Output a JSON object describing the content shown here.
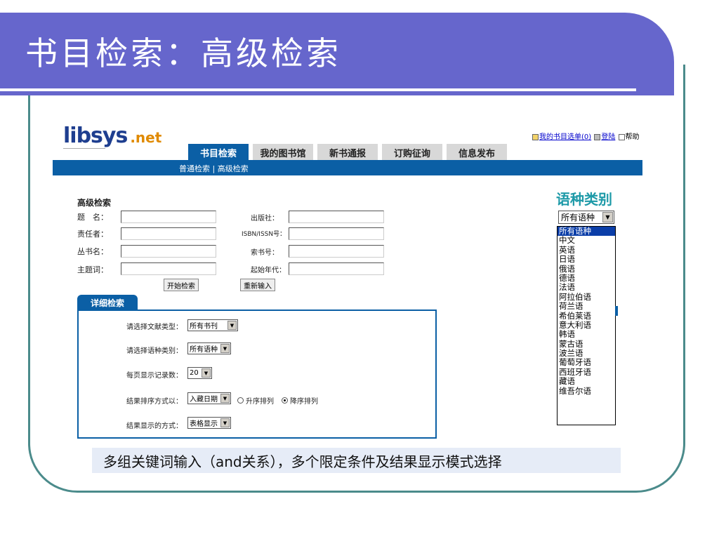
{
  "slide": {
    "title": "书目检索：高级检索",
    "caption": "多组关键词输入（and关系），多个限定条件及结果显示模式选择"
  },
  "colors": {
    "title_band": "#6666cc",
    "frame": "#4b8b8b",
    "nav_blue": "#0b5fa5",
    "lang_title": "#1e9aa8",
    "logo_blue": "#1e3e8f",
    "logo_orange": "#e08a00"
  },
  "site": {
    "logo_main": "libsys",
    "logo_suffix": ".net",
    "top_links": {
      "my_list": "我的书目选单(0)",
      "login": "登陆",
      "help": "帮助"
    },
    "tabs": [
      "书目检索",
      "我的图书馆",
      "新书通报",
      "订购征询",
      "信息发布"
    ],
    "subnav": "普通检索 | 高级检索"
  },
  "adv_search": {
    "heading": "高级检索",
    "labels": {
      "title": "题　名：",
      "author": "责任者：",
      "series": "丛书名：",
      "subject": "主题词：",
      "publisher": "出版社：",
      "isbn": "ISBN/ISSN号：",
      "callno": "索书号：",
      "year": "起始年代："
    },
    "search_button": "开始检索",
    "reset_button": "重新输入"
  },
  "detail": {
    "tab": "详细检索",
    "doc_type_label": "请选择文献类型：",
    "doc_type_value": "所有书刊",
    "lang_label": "请选择语种类别：",
    "lang_value": "所有语种",
    "per_page_label": "每页显示记录数：",
    "per_page_value": "20",
    "sort_label": "结果排序方式以：",
    "sort_value": "入藏日期",
    "asc_label": "升序排列",
    "desc_label": "降序排列",
    "display_label": "结果显示的方式：",
    "display_value": "表格显示"
  },
  "lang_panel": {
    "title": "语种类别",
    "selected": "所有语种",
    "options": [
      "所有语种",
      "中文",
      "英语",
      "日语",
      "俄语",
      "德语",
      "法语",
      "阿拉伯语",
      "荷兰语",
      "希伯莱语",
      "意大利语",
      "韩语",
      "蒙古语",
      "波兰语",
      "葡萄牙语",
      "西班牙语",
      "藏语",
      "维吾尔语"
    ]
  }
}
